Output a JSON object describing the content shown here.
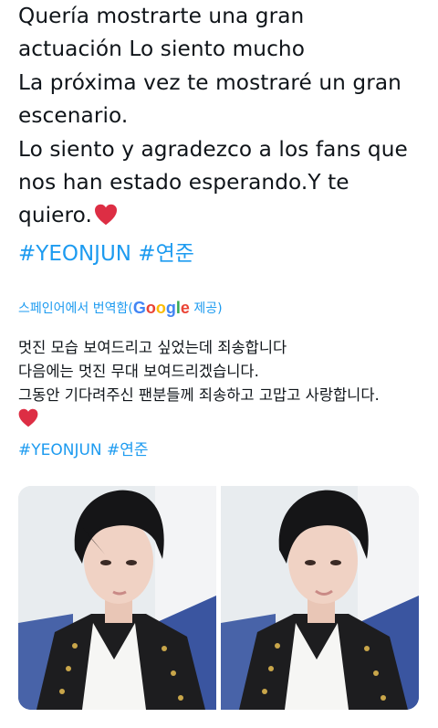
{
  "tweet": {
    "text_lines": [
      "Quería mostrarte una gran",
      "actuación Lo siento mucho",
      "La próxima vez te mostraré un gran",
      "escenario.",
      "Lo siento y agradezco a los fans que",
      "nos han estado esperando.Y te",
      "quiero."
    ],
    "hashtags": [
      "#YEONJUN",
      "#연준"
    ]
  },
  "translation": {
    "prefix": "스페인어에서 번역함(",
    "provider": "Google",
    "suffix": " 제공)",
    "lines": [
      "멋진 모습 보여드리고 싶었는데 죄송합니다",
      "다음에는 멋진 무대 보여드리겠습니다.",
      "그동안 기다려주신 팬분들께 죄송하고 고맙고 사랑합니다."
    ],
    "hashtags": [
      "#YEONJUN",
      "#연준"
    ]
  },
  "colors": {
    "link": "#1d9bf0",
    "heart": "#dd2e44",
    "google_blue": "#4285F4",
    "google_red": "#EA4335",
    "google_yellow": "#FBBC05",
    "google_green": "#34A853"
  },
  "icons": {
    "heart": "red-heart-emoji"
  },
  "media": {
    "photos": [
      "selfie-photo-left",
      "selfie-photo-right"
    ]
  }
}
